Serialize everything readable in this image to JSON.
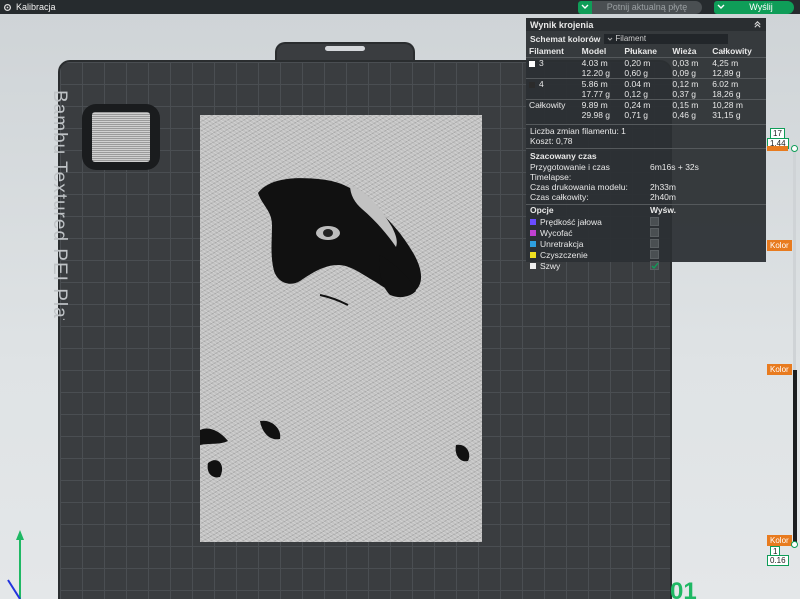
{
  "app": {
    "title": "Kalibracja"
  },
  "toolbar": {
    "slice_plate": "Potnij aktualną płytę",
    "send": "Wyślij"
  },
  "bed": {
    "label": "Bambu Textured PEI Plate",
    "plate_number": "01"
  },
  "panel": {
    "title": "Wynik krojenia",
    "scheme_label": "Schemat kolorów",
    "scheme_value": "Filament",
    "headers": [
      "Filament",
      "Model",
      "Płukane",
      "Wieża",
      "Całkowity"
    ],
    "rows": [
      {
        "filament": "3",
        "color": "#ffffff",
        "model": [
          "4.03 m",
          "12.20 g"
        ],
        "flush": [
          "0,20 m",
          "0,60 g"
        ],
        "tower": [
          "0,03 m",
          "0,09 g"
        ],
        "total": [
          "4,25 m",
          "12,89 g"
        ]
      },
      {
        "filament": "4",
        "color": "#2b2b2b",
        "model": [
          "5.86 m",
          "17.77 g"
        ],
        "flush": [
          "0.04 m",
          "0,12 g"
        ],
        "tower": [
          "0,12 m",
          "0,37 g"
        ],
        "total": [
          "6.02 m",
          "18,26 g"
        ]
      },
      {
        "filament": "Całkowity",
        "color": "",
        "model": [
          "9.89 m",
          "29.98 g"
        ],
        "flush": [
          "0,24 m",
          "0,71 g"
        ],
        "tower": [
          "0,15 m",
          "0,46 g"
        ],
        "total": [
          "10,28 m",
          "31,15 g"
        ]
      }
    ],
    "filament_changes": "Liczba zmian filamentu: 1",
    "cost": "Koszt: 0,78",
    "time_title": "Szacowany czas",
    "times": [
      {
        "label": "Przygotowanie i czas Timelapse:",
        "value": "6m16s + 32s"
      },
      {
        "label": "Czas drukowania modelu:",
        "value": "2h33m"
      },
      {
        "label": "Czas całkowity:",
        "value": "2h40m"
      }
    ],
    "options_header": "Opcje",
    "display_header": "Wyśw.",
    "options": [
      {
        "label": "Prędkość jałowa",
        "color": "#6a4cff",
        "checked": false
      },
      {
        "label": "Wycofać",
        "color": "#c040d0",
        "checked": false
      },
      {
        "label": "Unretrakcja",
        "color": "#2ea0e0",
        "checked": false
      },
      {
        "label": "Czyszczenie",
        "color": "#f0e020",
        "checked": false
      },
      {
        "label": "Szwy",
        "color": "#f0f0f0",
        "checked": true
      }
    ]
  },
  "slider": {
    "top_layer": "17",
    "top_height": "1.44",
    "bottom_layer": "1",
    "bottom_height": "0.16",
    "color_tag": "Kolor"
  },
  "colors": {
    "accent": "#0f9d58",
    "warning": "#e87b1f"
  }
}
